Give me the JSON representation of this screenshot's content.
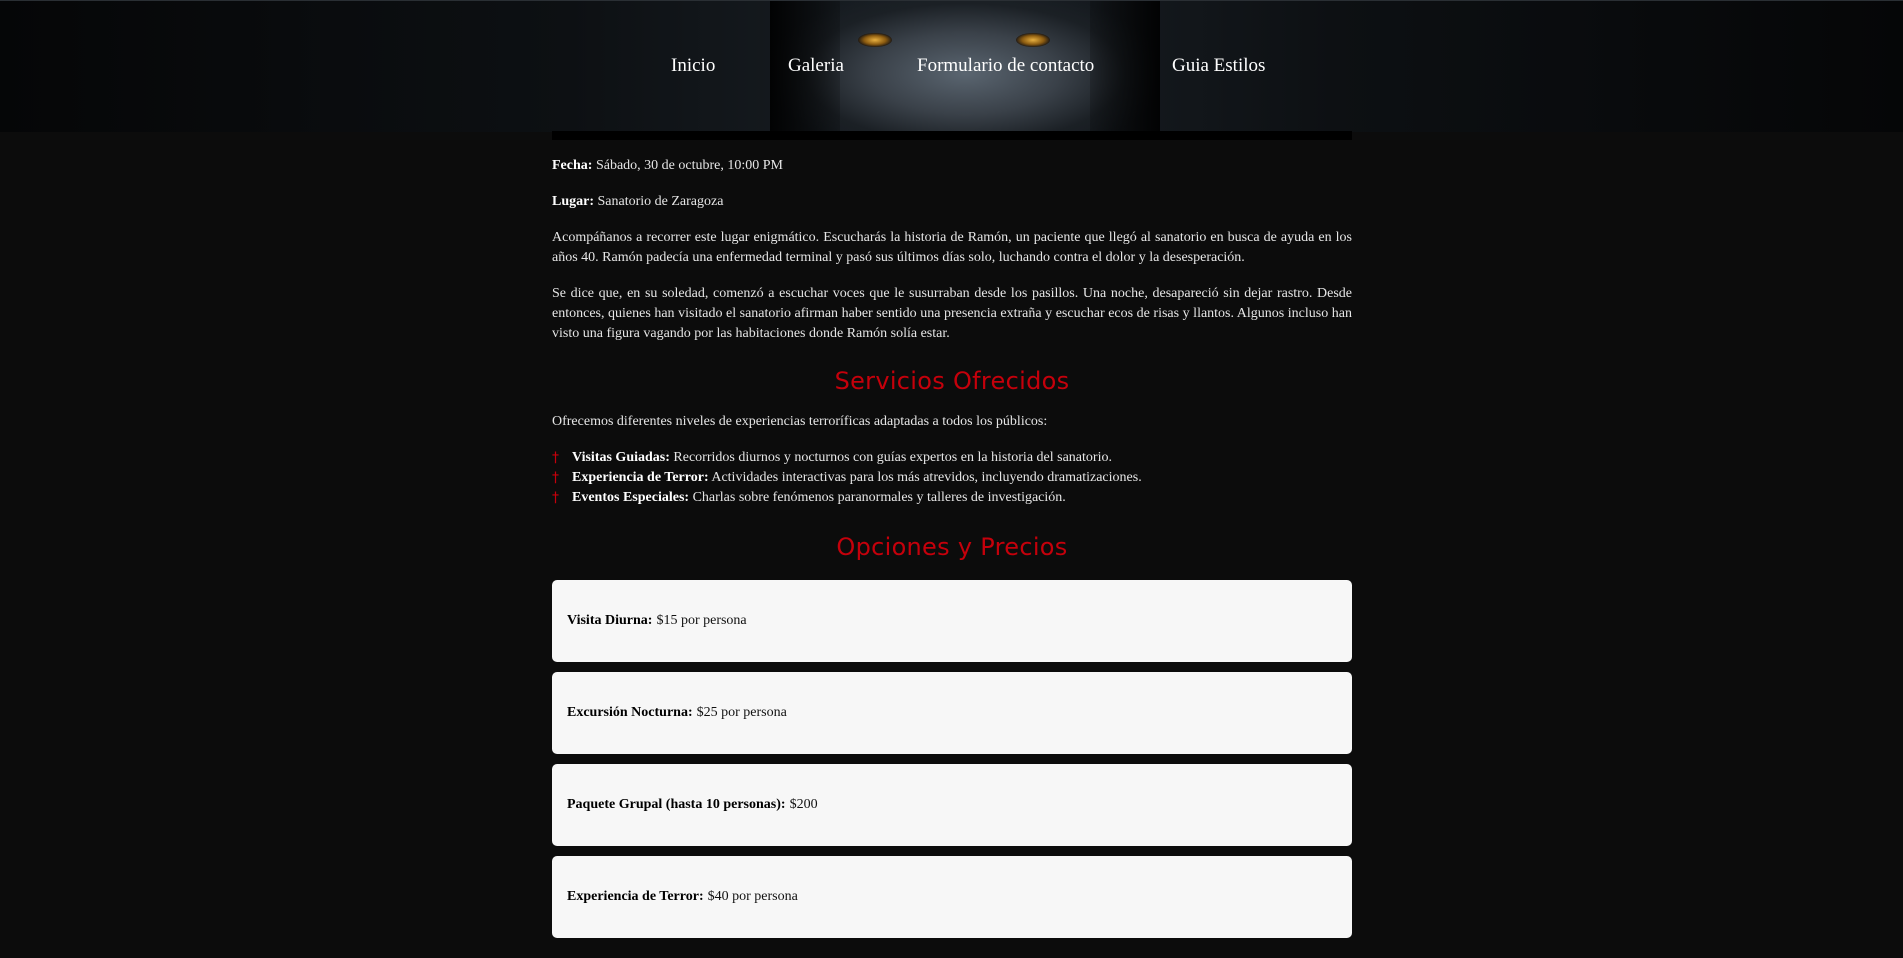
{
  "nav": {
    "items": [
      {
        "label": "Inicio"
      },
      {
        "label": "Galeria"
      },
      {
        "label": "Formulario de contacto"
      },
      {
        "label": "Guia Estilos"
      }
    ]
  },
  "event": {
    "date_label": "Fecha:",
    "date_value": "Sábado, 30 de octubre, 10:00 PM",
    "place_label": "Lugar:",
    "place_value": "Sanatorio de Zaragoza",
    "paragraphs": [
      "Acompáñanos a recorrer este lugar enigmático. Escucharás la historia de Ramón, un paciente que llegó al sanatorio en busca de ayuda en los años 40. Ramón padecía una enfermedad terminal y pasó sus últimos días solo, luchando contra el dolor y la desesperación.",
      "Se dice que, en su soledad, comenzó a escuchar voces que le susurraban desde los pasillos. Una noche, desapareció sin dejar rastro. Desde entonces, quienes han visitado el sanatorio afirman haber sentido una presencia extraña y escuchar ecos de risas y llantos. Algunos incluso han visto una figura vagando por las habitaciones donde Ramón solía estar."
    ]
  },
  "services": {
    "title": "Servicios Ofrecidos",
    "intro": "Ofrecemos diferentes niveles de experiencias terroríficas adaptadas a todos los públicos:",
    "bullet": "†",
    "items": [
      {
        "name": "Visitas Guiadas:",
        "desc": "Recorridos diurnos y nocturnos con guías expertos en la historia del sanatorio."
      },
      {
        "name": "Experiencia de Terror:",
        "desc": "Actividades interactivas para los más atrevidos, incluyendo dramatizaciones."
      },
      {
        "name": "Eventos Especiales:",
        "desc": "Charlas sobre fenómenos paranormales y talleres de investigación."
      }
    ]
  },
  "options": {
    "title": "Opciones y Precios",
    "items": [
      {
        "name": "Visita Diurna:",
        "price": "$15 por persona"
      },
      {
        "name": "Excursión Nocturna:",
        "price": "$25 por persona"
      },
      {
        "name": "Paquete Grupal (hasta 10 personas):",
        "price": "$200"
      },
      {
        "name": "Experiencia de Terror:",
        "price": "$40 por persona"
      }
    ]
  },
  "colors": {
    "accent": "#c5000b",
    "background": "#0c0c0c",
    "card": "#f7f7f7"
  }
}
